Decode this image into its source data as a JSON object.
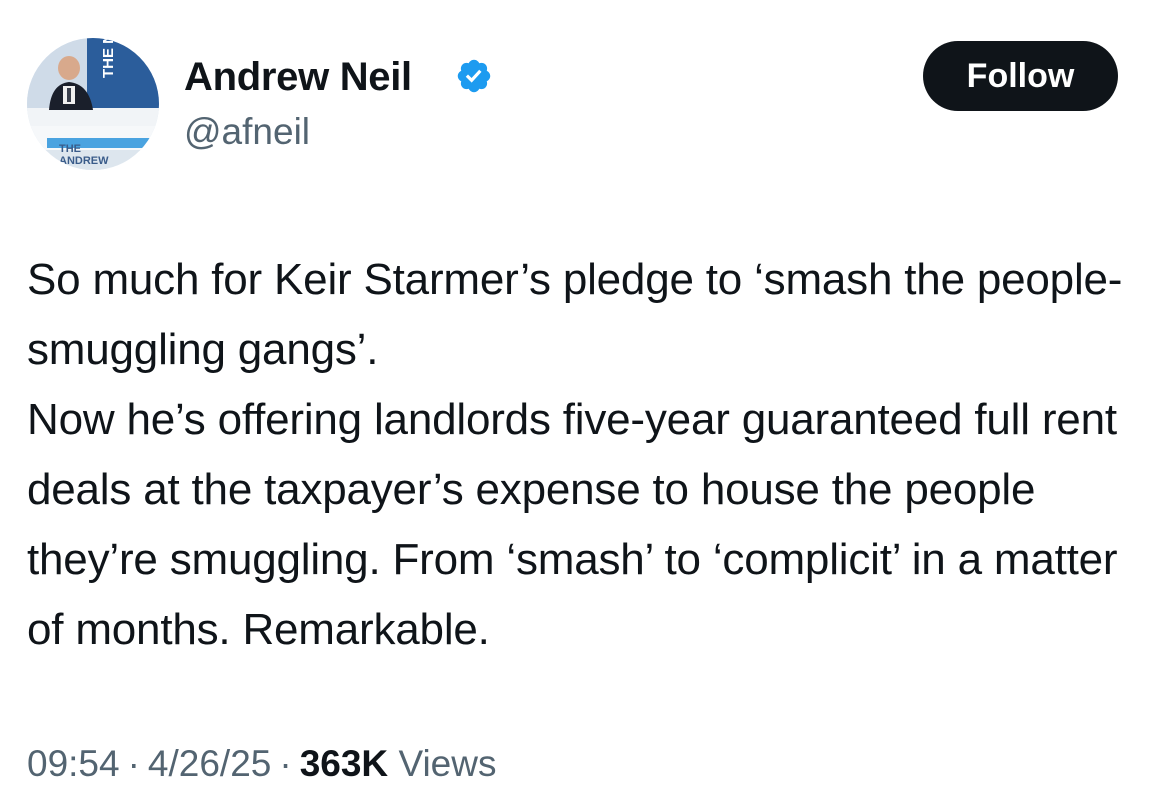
{
  "author": {
    "display_name": "Andrew Neil",
    "handle": "@afneil",
    "verified": true,
    "avatar_text": {
      "top": "THE NEIL",
      "bottom_line1": "THE",
      "bottom_line2": "ANDREW"
    }
  },
  "follow_button": {
    "label": "Follow"
  },
  "tweet": {
    "paragraphs": [
      "So much for Keir Starmer’s pledge to ‘smash the people-smuggling gangs’.",
      "Now he’s offering landlords five-year guaranteed full rent deals at the taxpayer’s expense to house the people they’re smuggling. From ‘smash’ to ‘complicit’ in a matter of months. Remarkable."
    ]
  },
  "meta": {
    "time": "09:54",
    "date": "4/26/25",
    "separator": "·",
    "views_count": "363K",
    "views_label": "Views"
  },
  "colors": {
    "text": "#0f1419",
    "secondary_text": "#536471",
    "verified_blue": "#1d9bf0",
    "button_bg": "#0f1419",
    "background": "#ffffff"
  },
  "icons": {
    "verified": "verified-badge-icon"
  }
}
